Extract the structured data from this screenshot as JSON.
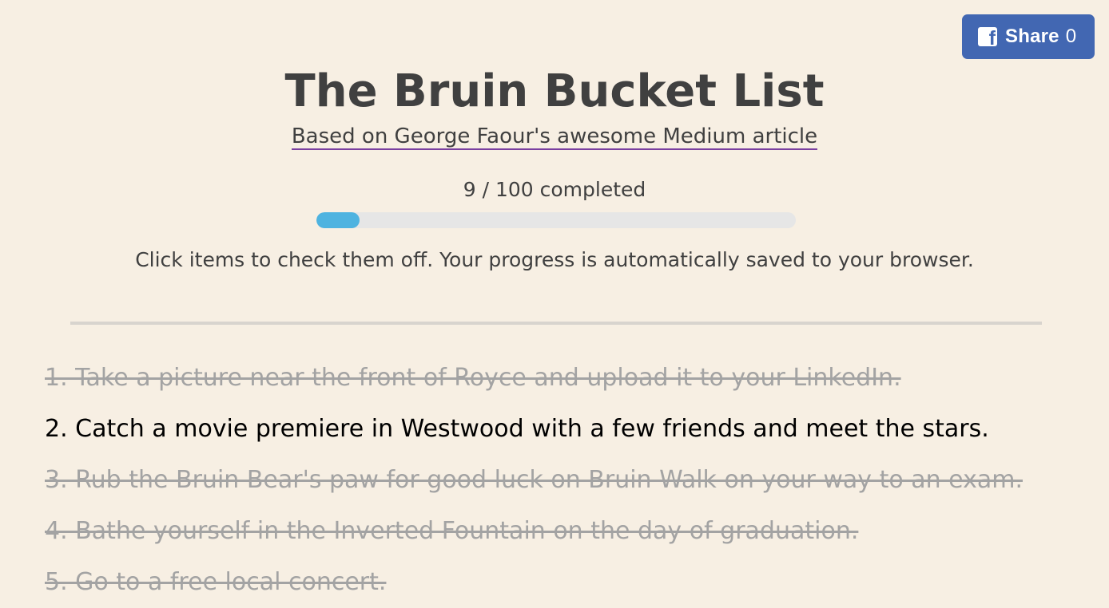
{
  "share": {
    "label": "Share",
    "count": "0",
    "icon": "facebook-icon"
  },
  "header": {
    "title": "The Bruin Bucket List",
    "subtitle_link": "Based on George Faour's awesome Medium article"
  },
  "progress": {
    "text": "9 / 100 completed",
    "completed": 9,
    "total": 100
  },
  "instructions": "Click items to check them off. Your progress is automatically saved to your browser.",
  "items": [
    {
      "text": "1. Take a picture near the front of Royce and upload it to your LinkedIn.",
      "completed": true
    },
    {
      "text": "2. Catch a movie premiere in Westwood with a few friends and meet the stars.",
      "completed": false
    },
    {
      "text": "3. Rub the Bruin Bear's paw for good luck on Bruin Walk on your way to an exam.",
      "completed": true
    },
    {
      "text": "4. Bathe yourself in the Inverted Fountain on the day of graduation.",
      "completed": true
    },
    {
      "text": "5. Go to a free local concert.",
      "completed": true
    }
  ],
  "colors": {
    "background": "#f7efe3",
    "share_button": "#4267b2",
    "progress_fill": "#4eb3e0",
    "progress_track": "#e6e6e6",
    "completed_text": "#a3a3a3",
    "link_underline": "#7a3fa0"
  }
}
